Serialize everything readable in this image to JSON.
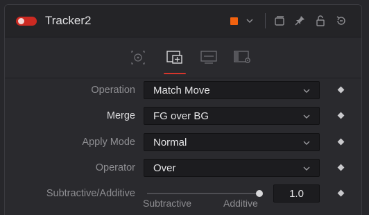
{
  "header": {
    "toggle_state": "on",
    "title": "Tracker2",
    "color_swatch": "#f2620f",
    "icons": [
      "chevron-down-icon",
      "version-icon",
      "pin-icon",
      "lock-icon",
      "reset-icon"
    ]
  },
  "tabs": {
    "items": [
      "controls-icon",
      "operation-icon",
      "display-icon",
      "settings-icon"
    ],
    "active_index": 1
  },
  "rows": [
    {
      "label": "Operation",
      "value": "Match Move"
    },
    {
      "label": "Merge",
      "value": "FG over BG"
    },
    {
      "label": "Apply Mode",
      "value": "Normal"
    },
    {
      "label": "Operator",
      "value": "Over"
    }
  ],
  "slider": {
    "label": "Subtractive/Additive",
    "value": "1.0",
    "fraction": 1.0,
    "min_label": "Subtractive",
    "max_label": "Additive"
  },
  "colors": {
    "accent_red": "#d7362c",
    "toggle_red": "#cc2a22",
    "panel": "#2a2a2e"
  }
}
